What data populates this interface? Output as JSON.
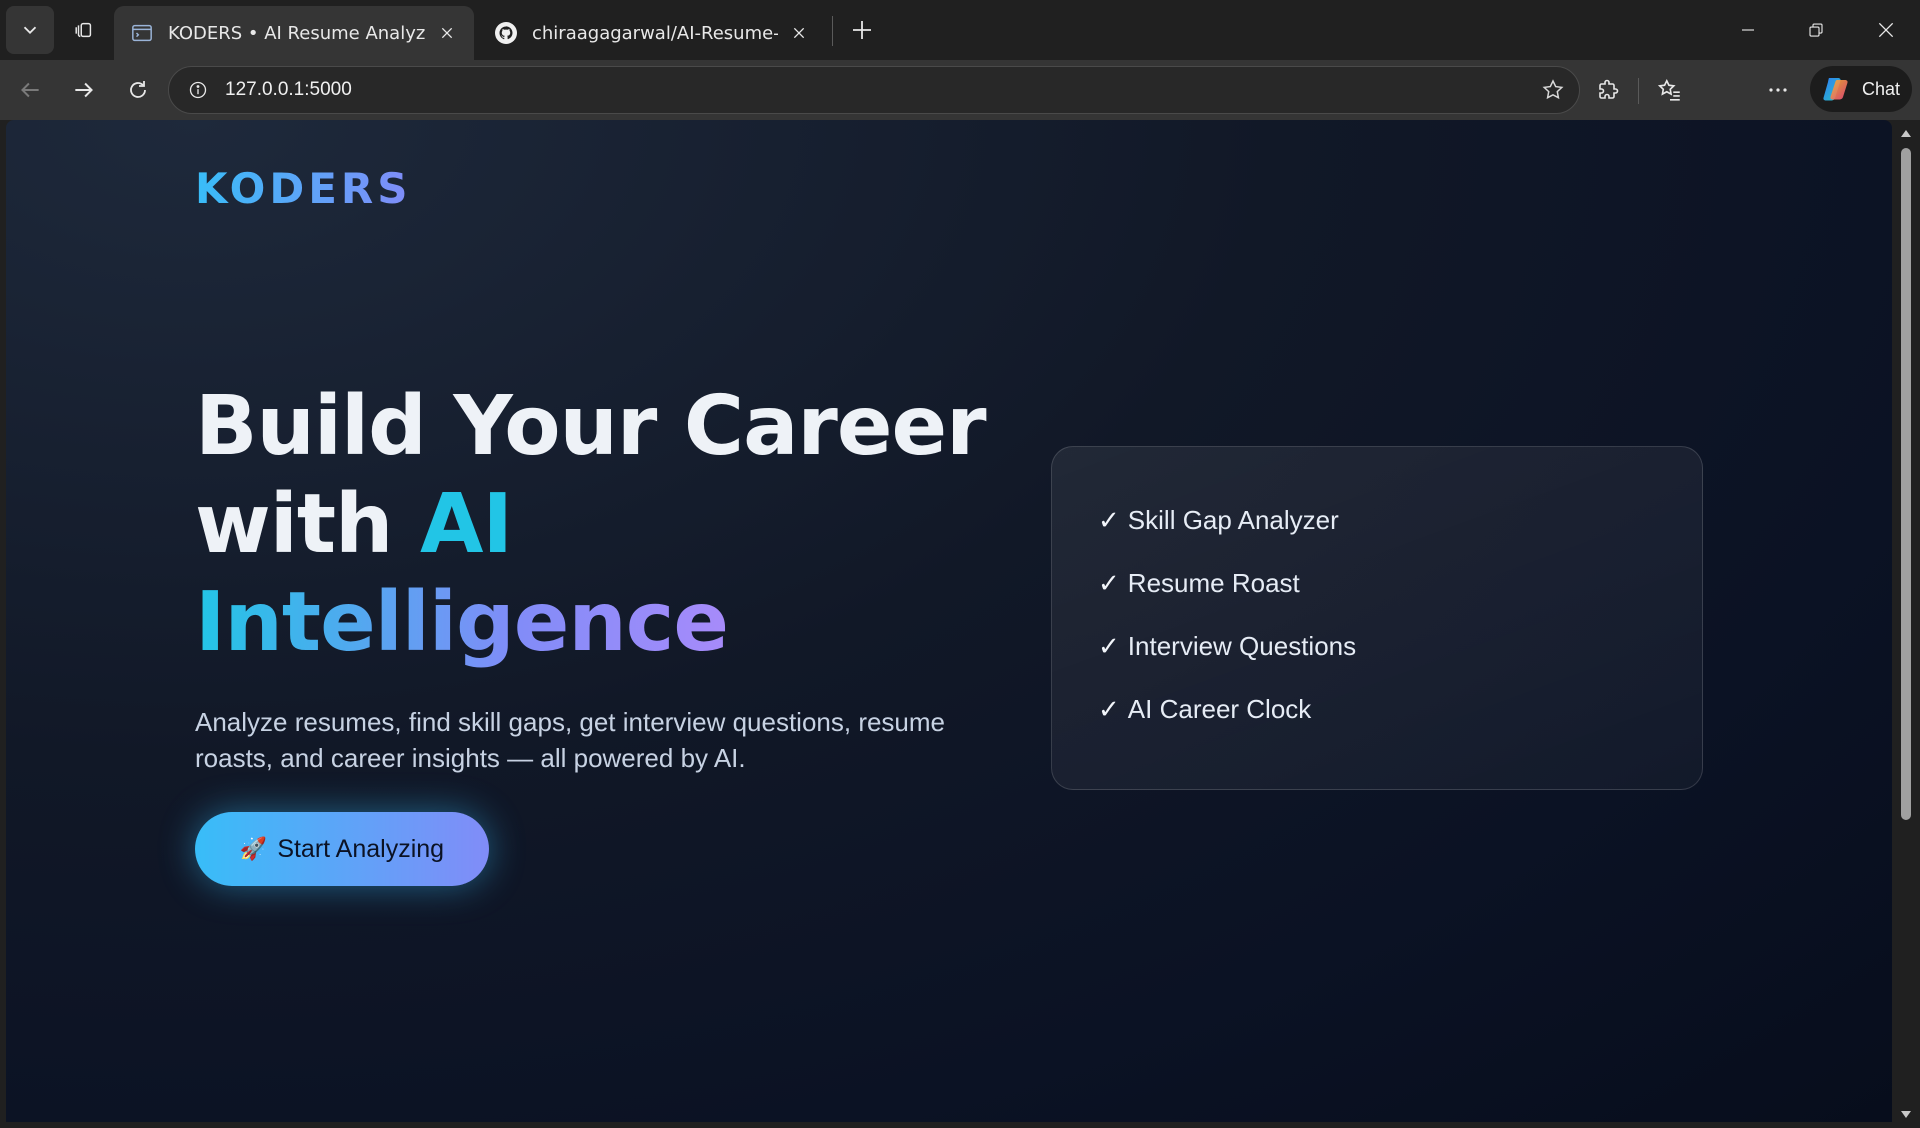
{
  "browser": {
    "tabs": [
      {
        "title": "KODERS • AI Resume Analyzer",
        "active": true,
        "favicon": "terminal-icon"
      },
      {
        "title": "chiraagagarwal/AI-Resume-Analyz",
        "active": false,
        "favicon": "github-icon"
      }
    ],
    "url": "127.0.0.1:5000",
    "chat_label": "Chat"
  },
  "page": {
    "brand": "KODERS",
    "hero": {
      "line1": "Build Your Career",
      "line2_prefix": "with",
      "line2_accent": "AI",
      "line3": "Intelligence",
      "subtitle": "Analyze resumes, find skill gaps, get interview questions, resume roasts, and career insights — all powered by AI.",
      "cta_icon": "🚀",
      "cta_label": "Start Analyzing"
    },
    "features": [
      "Skill Gap Analyzer",
      "Resume Roast",
      "Interview Questions",
      "AI Career Clock"
    ],
    "check_glyph": "✓"
  },
  "colors": {
    "accent_cyan": "#22c5e6",
    "accent_blue": "#38bdf8",
    "accent_violet": "#818cf8",
    "background": "#0b1224"
  }
}
